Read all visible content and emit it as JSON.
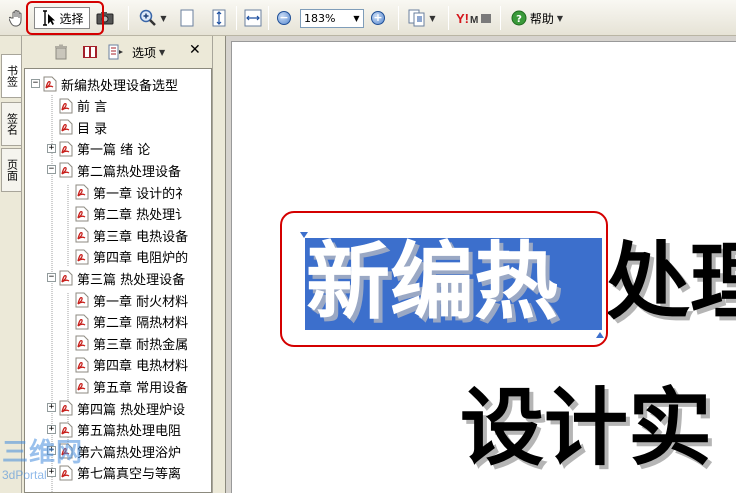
{
  "toolbar": {
    "select_label": "选择",
    "zoom_value": "183%",
    "help_label": "帮助"
  },
  "side_tabs": [
    "书签",
    "签名",
    "页面"
  ],
  "bookmarks_toolbar": {
    "options_label": "选项"
  },
  "bookmarks": [
    {
      "label": "新编热处理设备选型",
      "level": 0,
      "expander": "minus"
    },
    {
      "label": "前 言",
      "level": 1,
      "expander": "none"
    },
    {
      "label": "目 录",
      "level": 1,
      "expander": "none"
    },
    {
      "label": "第一篇 绪 论",
      "level": 1,
      "expander": "plus"
    },
    {
      "label": "第二篇热处理设备",
      "level": 1,
      "expander": "minus"
    },
    {
      "label": "第一章 设计的礻",
      "level": 2,
      "expander": "none"
    },
    {
      "label": "第二章 热处理讠",
      "level": 2,
      "expander": "none"
    },
    {
      "label": "第三章 电热设备",
      "level": 2,
      "expander": "none"
    },
    {
      "label": "第四章 电阻炉的",
      "level": 2,
      "expander": "none"
    },
    {
      "label": "第三篇 热处理设备",
      "level": 1,
      "expander": "minus"
    },
    {
      "label": "第一章 耐火材料",
      "level": 2,
      "expander": "none"
    },
    {
      "label": "第二章 隔热材料",
      "level": 2,
      "expander": "none"
    },
    {
      "label": "第三章 耐热金属",
      "level": 2,
      "expander": "none"
    },
    {
      "label": "第四章 电热材料",
      "level": 2,
      "expander": "none"
    },
    {
      "label": "第五章 常用设备",
      "level": 2,
      "expander": "none"
    },
    {
      "label": "第四篇 热处理炉设",
      "level": 1,
      "expander": "plus"
    },
    {
      "label": "第五篇热处理电阻",
      "level": 1,
      "expander": "plus"
    },
    {
      "label": "第六篇热处理浴炉",
      "level": 1,
      "expander": "plus"
    },
    {
      "label": "第七篇真空与等离",
      "level": 1,
      "expander": "plus"
    }
  ],
  "document": {
    "title_selected": "新编热",
    "title_rest": "处理",
    "subtitle": "设计实"
  },
  "watermark": {
    "text_top": "三维网",
    "text_bottom": "3dPortal"
  },
  "colors": {
    "selection": "#3c6fcc",
    "highlight_outline": "#d40000",
    "pdf_icon": "#c8201c"
  }
}
